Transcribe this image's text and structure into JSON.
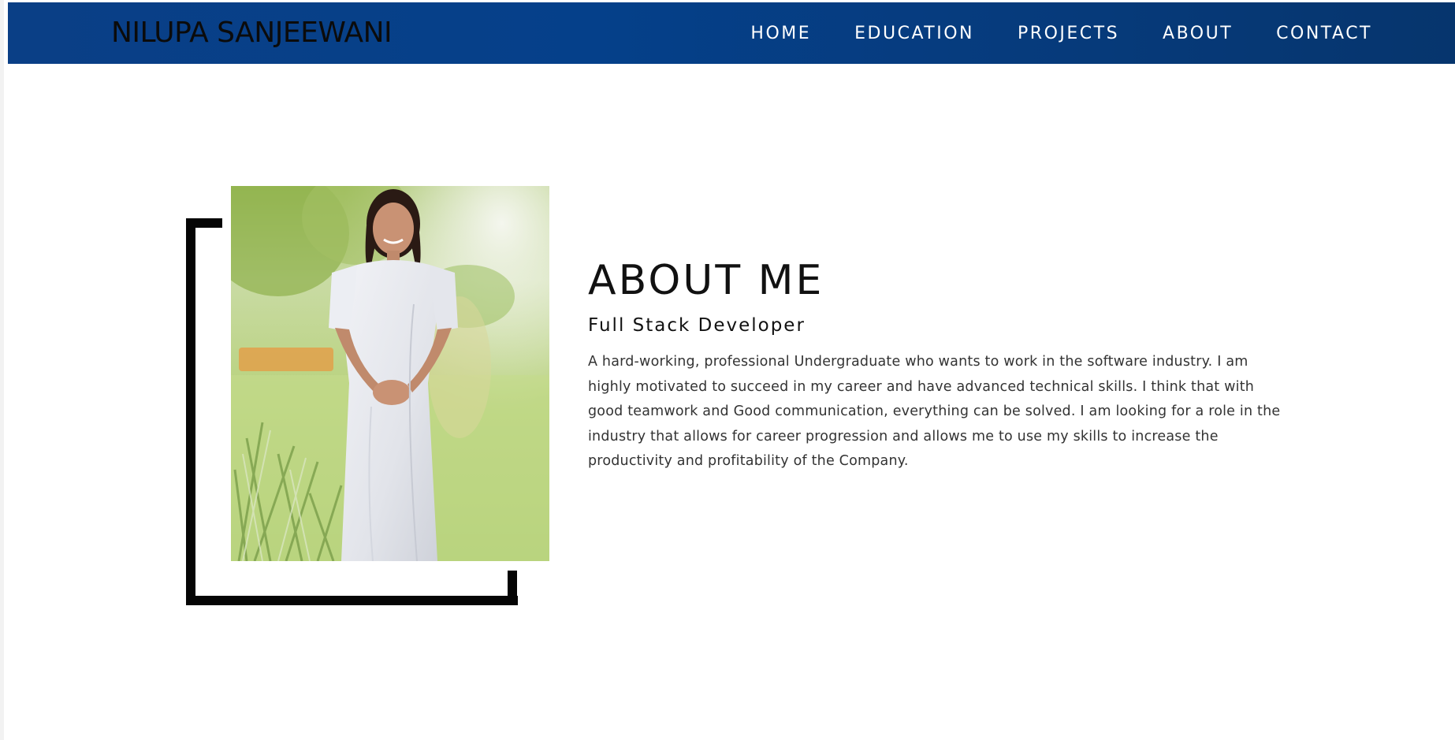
{
  "brand": {
    "name": "NILUPA SANJEEWANI"
  },
  "nav": {
    "items": [
      {
        "label": "HOME"
      },
      {
        "label": "EDUCATION"
      },
      {
        "label": "PROJECTS"
      },
      {
        "label": "ABOUT"
      },
      {
        "label": "CONTACT"
      }
    ]
  },
  "about": {
    "title": "ABOUT ME",
    "subtitle": "Full Stack Developer",
    "description": "A hard-working, professional Undergraduate who wants to work in the software industry. I am highly motivated to succeed in my career and have advanced technical skills. I think that with good teamwork and Good communication, everything can be solved. I am looking for a role in the industry that allows for career progression and allows me to use my skills to increase the productivity and profitability of the Company."
  },
  "colors": {
    "navbar": "#05408a",
    "frame": "#050505",
    "text": "#111111"
  }
}
